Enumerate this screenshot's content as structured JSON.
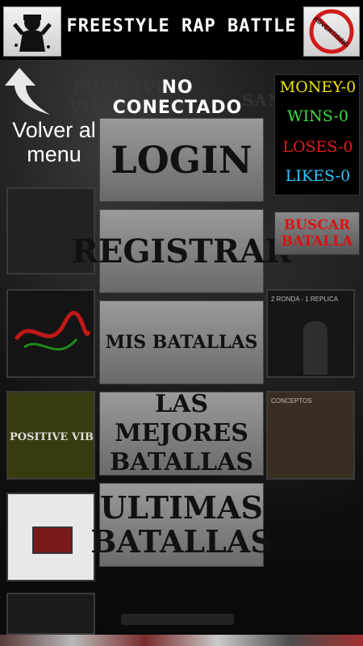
{
  "header": {
    "title": "FREESTYLE RAP BATTLE",
    "left_icon": "rapper-logo-icon",
    "right_icon": "no-advertising-icon",
    "right_icon_text": "ADVERTISING"
  },
  "back": {
    "label": "Volver al menu",
    "icon": "curved-arrow-up-icon"
  },
  "connection_status": "NO CONECTADO",
  "background_words": [
    "POSITIVE",
    "VIBRATION",
    "SANTO"
  ],
  "menu": {
    "login": "LOGIN",
    "registrar": "REGISTRAR",
    "mis_batallas": "MIS BATALLAS",
    "mejores": "LAS MEJORES BATALLAS",
    "ultimas": "ULTIMAS BATALLAS"
  },
  "stats": {
    "money": "MONEY-0",
    "wins": "WINS-0",
    "loses": "LOSES-0",
    "likes": "LIKES-0"
  },
  "search_button": "BUSCAR BATALLA",
  "thumbnails": {
    "left_2": "POSITIVE VIBRATION",
    "right_1": "2 RONDA - 1 REPLICA",
    "right_2": "CONCEPTOS"
  },
  "colors": {
    "money": "#f2e600",
    "wins": "#3ee03e",
    "loses": "#e81a1a",
    "likes": "#2ec8ff",
    "search": "#e01010"
  }
}
